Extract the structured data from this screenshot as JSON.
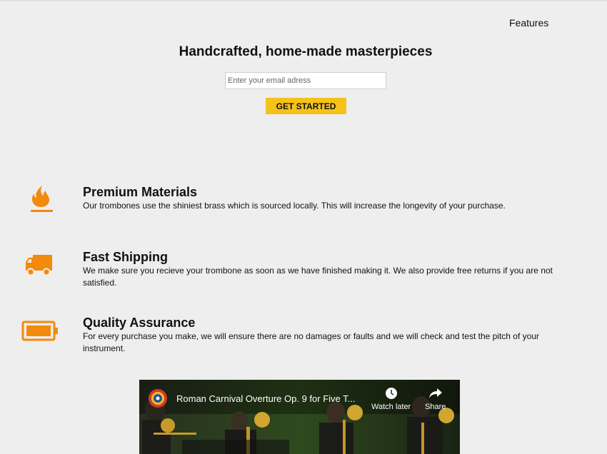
{
  "nav": {
    "features_label": "Features"
  },
  "hero": {
    "title": "Handcrafted, home-made masterpieces",
    "email_placeholder": "Enter your email adress",
    "cta_label": "GET STARTED"
  },
  "features": [
    {
      "icon": "fire-icon",
      "title": "Premium Materials",
      "description": "Our trombones use the shiniest brass which is sourced locally. This will increase the longevity of your purchase."
    },
    {
      "icon": "truck-icon",
      "title": "Fast Shipping",
      "description": "We make sure you recieve your trombone as soon as we have finished making it. We also provide free returns if you are not satisfied."
    },
    {
      "icon": "battery-full-icon",
      "title": "Quality Assurance",
      "description": "For every purchase you make, we will ensure there are no damages or faults and we will check and test the pitch of your instrument."
    }
  ],
  "video": {
    "title": "Roman Carnival Overture Op. 9 for Five T...",
    "watch_later_label": "Watch later",
    "share_label": "Share",
    "channel_logo_icon": "channel-seal-icon"
  },
  "colors": {
    "background": "#eeeeee",
    "accent_orange": "#f28a0c",
    "cta_yellow": "#f5c21a",
    "text": "#111111"
  }
}
